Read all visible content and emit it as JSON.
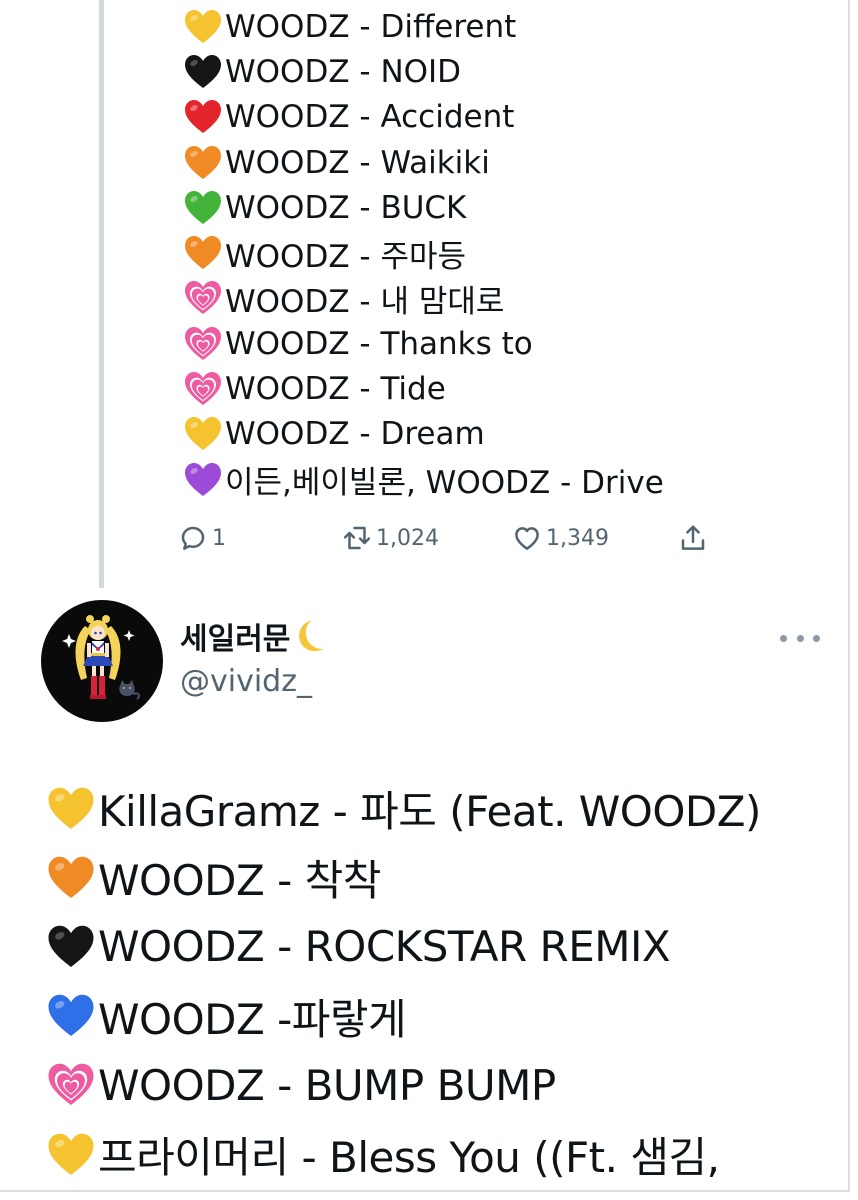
{
  "tweet1": {
    "songs": [
      {
        "heart": "yellow-heart",
        "color": "#f5c32f",
        "text": "WOODZ - Different"
      },
      {
        "heart": "black-heart",
        "color": "#151515",
        "text": "WOODZ - NOID"
      },
      {
        "heart": "red-heart",
        "color": "#e3242b",
        "text": "WOODZ - Accident"
      },
      {
        "heart": "orange-heart",
        "color": "#f08a24",
        "text": "WOODZ - Waikiki"
      },
      {
        "heart": "green-heart",
        "color": "#43b33a",
        "text": "WOODZ - BUCK"
      },
      {
        "heart": "orange-heart",
        "color": "#f08a24",
        "text": "WOODZ - 주마등"
      },
      {
        "heart": "growing-heart",
        "color": "#ef5ba1",
        "text": "WOODZ - 내 맘대로"
      },
      {
        "heart": "growing-heart",
        "color": "#ef5ba1",
        "text": "WOODZ - Thanks to"
      },
      {
        "heart": "growing-heart",
        "color": "#ef5ba1",
        "text": "WOODZ - Tide"
      },
      {
        "heart": "yellow-heart",
        "color": "#f5c32f",
        "text": "WOODZ - Dream"
      },
      {
        "heart": "purple-heart",
        "color": "#9b4bd8",
        "text": "이든,베이빌론, WOODZ - Drive"
      }
    ],
    "actions": {
      "reply_count": "1",
      "retweet_count": "1,024",
      "like_count": "1,349"
    }
  },
  "tweet2": {
    "display_name": "세일러문",
    "name_emoji": "crescent-moon",
    "handle": "@vividz_",
    "avatar": "sailor-moon-avatar",
    "songs": [
      {
        "heart": "yellow-heart",
        "color": "#f5c32f",
        "text": "KillaGramz - 파도 (Feat. WOODZ)"
      },
      {
        "heart": "orange-heart",
        "color": "#f08a24",
        "text": "WOODZ - 착착"
      },
      {
        "heart": "black-heart",
        "color": "#151515",
        "text": "WOODZ - ROCKSTAR REMIX"
      },
      {
        "heart": "blue-heart",
        "color": "#2f6fe8",
        "text": "WOODZ -파랗게"
      },
      {
        "heart": "growing-heart",
        "color": "#ef5ba1",
        "text": "WOODZ - BUMP BUMP"
      },
      {
        "heart": "yellow-heart",
        "color": "#f5c32f",
        "text": "프라이머리 - Bless You ((Ft. 샘김,"
      }
    ]
  }
}
